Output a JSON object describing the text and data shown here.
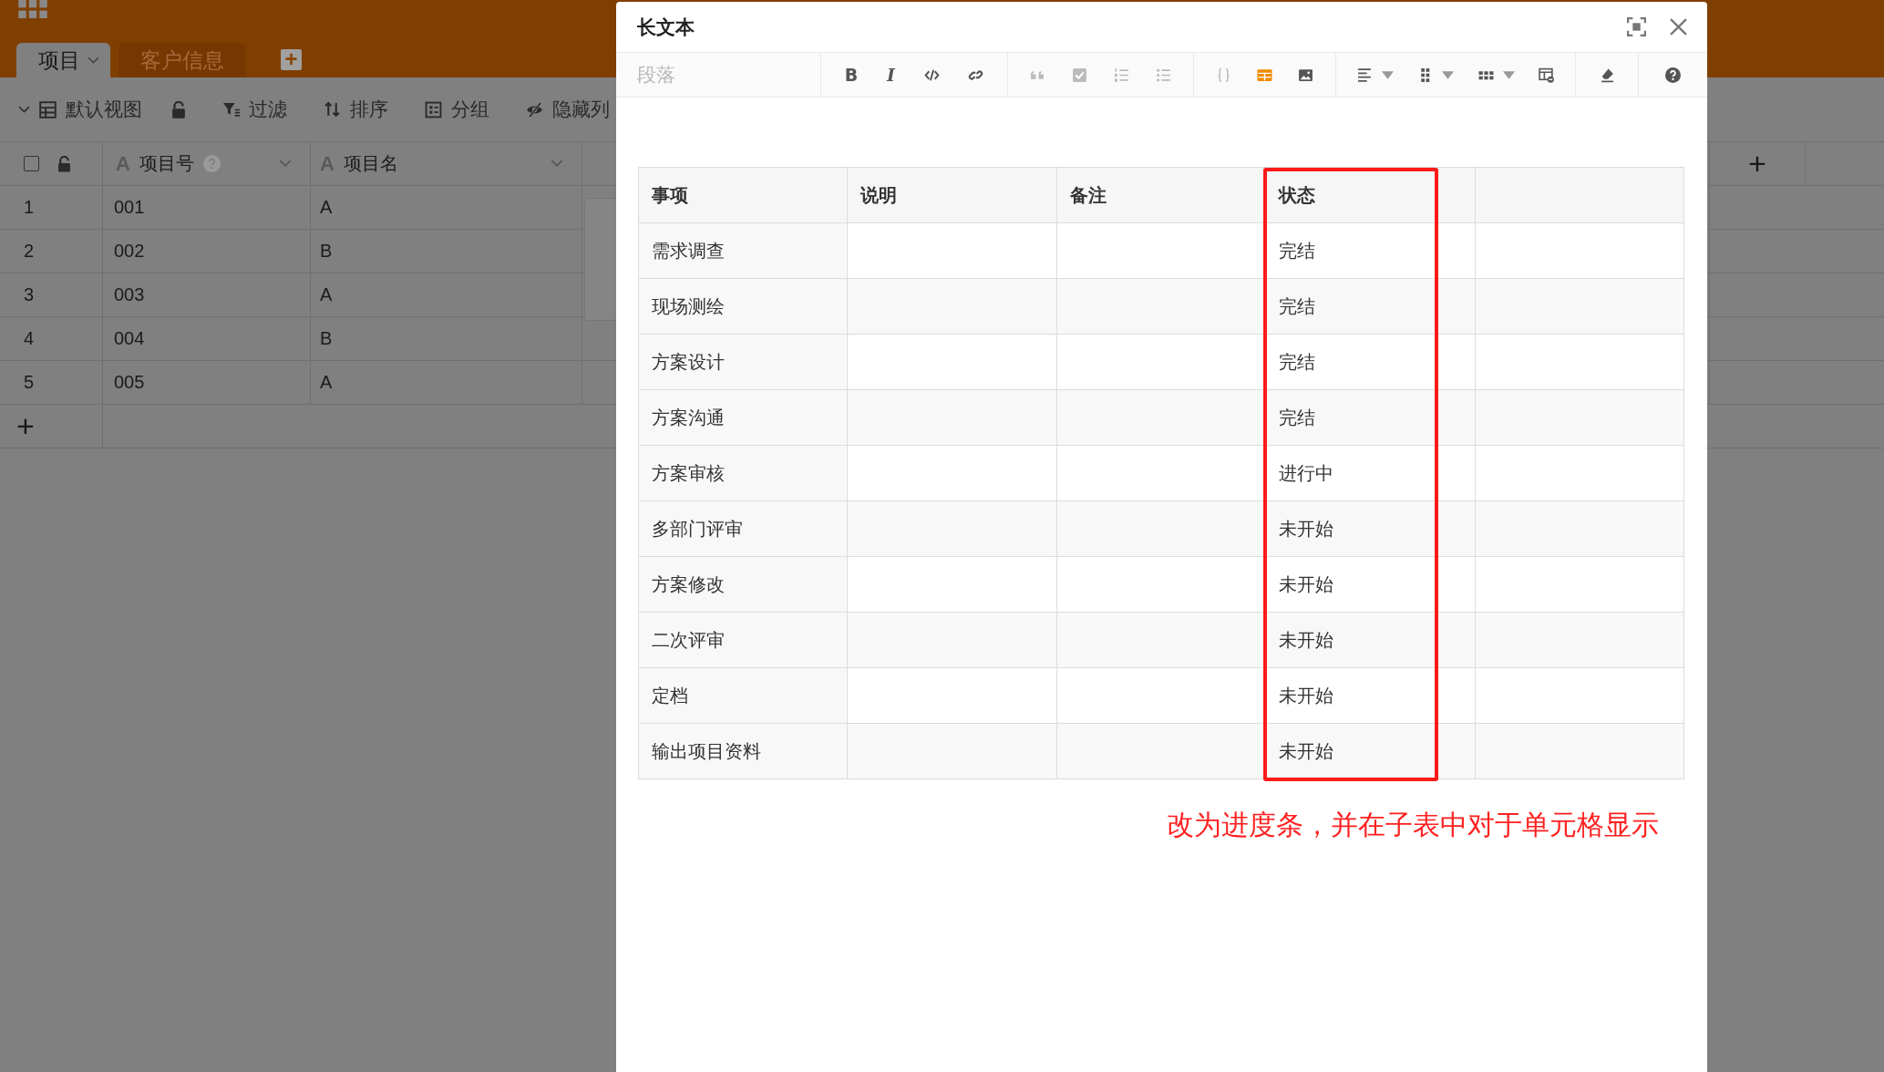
{
  "app": {
    "tabs": [
      {
        "label": "项目",
        "selected": true
      },
      {
        "label": "客户信息",
        "selected": false
      }
    ],
    "add_tab": "+",
    "view_bar": {
      "view": "默认视图",
      "items": [
        {
          "kind": "filter",
          "label": "过滤"
        },
        {
          "kind": "sort",
          "label": "排序"
        },
        {
          "kind": "group",
          "label": "分组"
        },
        {
          "kind": "hide",
          "label": "隐藏列"
        }
      ]
    },
    "grid": {
      "columns": [
        {
          "type_glyph": "A",
          "label": "项目号",
          "help": true
        },
        {
          "type_glyph": "A",
          "label": "项目名",
          "help": false
        }
      ],
      "rows": [
        {
          "number": "1",
          "cells": [
            "001",
            "A"
          ]
        },
        {
          "number": "2",
          "cells": [
            "002",
            "B"
          ]
        },
        {
          "number": "3",
          "cells": [
            "003",
            "A"
          ]
        },
        {
          "number": "4",
          "cells": [
            "004",
            "B"
          ]
        },
        {
          "number": "5",
          "cells": [
            "005",
            "A"
          ]
        }
      ],
      "add_row": "+",
      "add_column": "+",
      "select_all": {
        "checked": false
      }
    }
  },
  "dialog": {
    "title": "长文本",
    "paragraph_select": {
      "placeholder": "段落"
    },
    "toolbar": [
      {
        "tools": [
          {
            "kind": "bold",
            "glyph": "B",
            "disabled": false,
            "active": false
          },
          {
            "kind": "italic",
            "glyph": "I",
            "disabled": false,
            "active": false
          },
          {
            "kind": "code",
            "disabled": false,
            "active": false
          },
          {
            "kind": "link",
            "disabled": false,
            "active": false
          }
        ]
      },
      {
        "tools": [
          {
            "kind": "quote",
            "disabled": true,
            "active": false
          },
          {
            "kind": "task",
            "disabled": true,
            "active": false
          },
          {
            "kind": "ordered-list",
            "disabled": true,
            "active": false
          },
          {
            "kind": "bullet-list",
            "disabled": true,
            "active": false
          }
        ]
      },
      {
        "tools": [
          {
            "kind": "code-block",
            "disabled": true,
            "active": false
          },
          {
            "kind": "table",
            "disabled": false,
            "active": true
          },
          {
            "kind": "image",
            "disabled": false,
            "active": false
          }
        ]
      },
      {
        "tools": [
          {
            "kind": "align",
            "dropdown": true,
            "disabled": false,
            "active": false
          },
          {
            "kind": "columns",
            "dropdown": true,
            "disabled": false,
            "active": false
          },
          {
            "kind": "rows",
            "dropdown": true,
            "disabled": false,
            "active": false
          },
          {
            "kind": "delete-table",
            "disabled": false,
            "active": false
          }
        ]
      },
      {
        "tools": [
          {
            "kind": "eraser",
            "disabled": false,
            "active": false
          }
        ]
      },
      {
        "tools": [
          {
            "kind": "help",
            "disabled": false,
            "active": false
          }
        ]
      }
    ],
    "table": {
      "columns": [
        {
          "kind": "name",
          "label": "事项",
          "highlighted": false
        },
        {
          "kind": "text",
          "label": "说明",
          "highlighted": false
        },
        {
          "kind": "text",
          "label": "备注",
          "highlighted": false
        },
        {
          "kind": "status",
          "label": "状态",
          "highlighted": true
        },
        {
          "kind": "text",
          "highlighted": false
        }
      ],
      "rows": [
        {
          "item": "需求调查",
          "status": "完结"
        },
        {
          "item": "现场测绘",
          "status": "完结"
        },
        {
          "item": "方案设计",
          "status": "完结"
        },
        {
          "item": "方案沟通",
          "status": "完结"
        },
        {
          "item": "方案审核",
          "status": "进行中"
        },
        {
          "item": "多部门评审",
          "status": "未开始"
        },
        {
          "item": "方案修改",
          "status": "未开始"
        },
        {
          "item": "二次评审",
          "status": "未开始"
        },
        {
          "item": "定档",
          "status": "未开始"
        },
        {
          "item": "输出项目资料",
          "status": "未开始"
        }
      ]
    },
    "annotation": "改为进度条，并在子表中对于单元格显示"
  }
}
